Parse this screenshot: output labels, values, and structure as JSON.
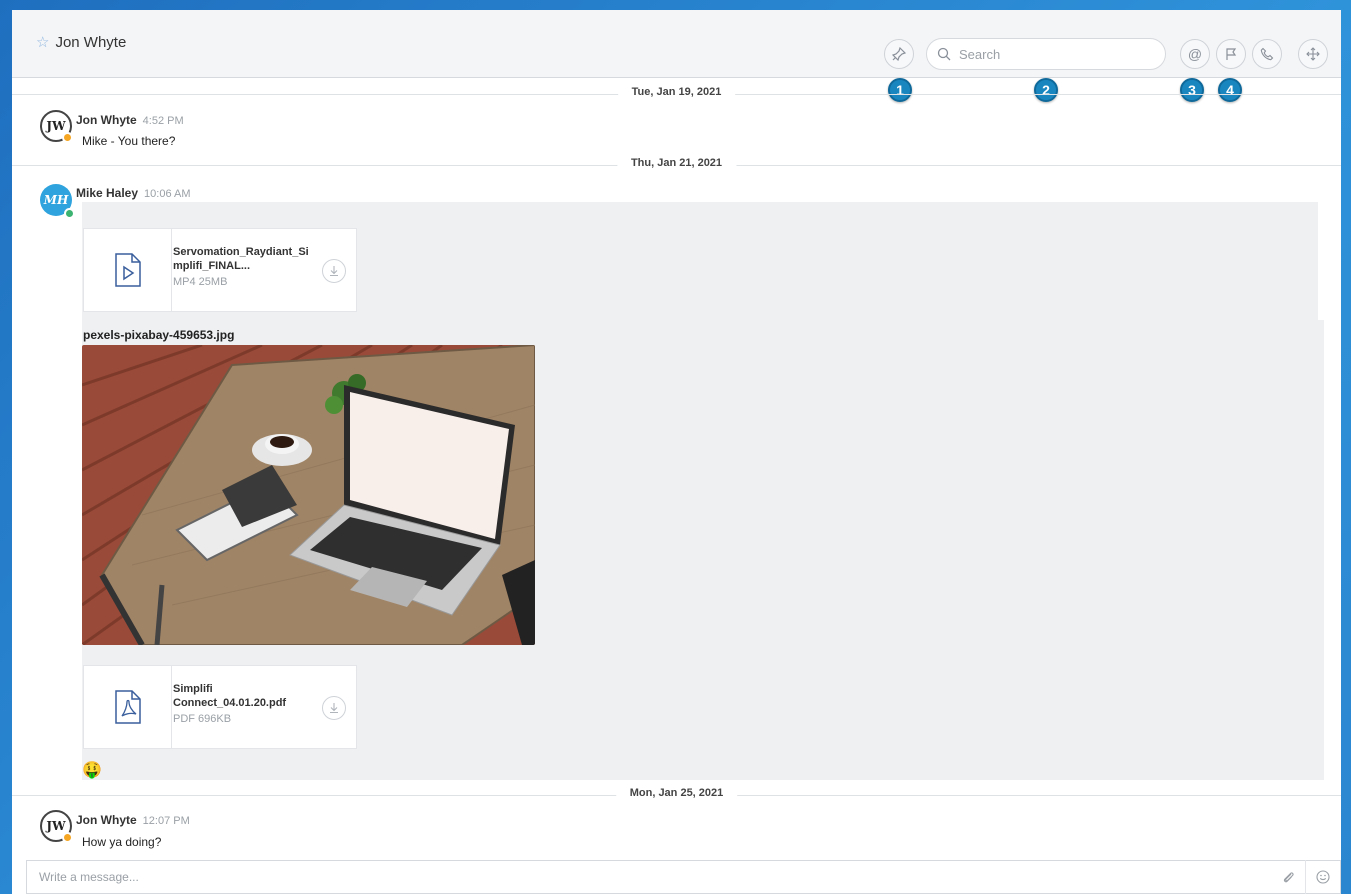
{
  "header": {
    "title": "Jon Whyte",
    "search_placeholder": "Search",
    "callouts": [
      "1",
      "2",
      "3",
      "4"
    ]
  },
  "dates": [
    "Tue, Jan 19, 2021",
    "Thu, Jan 21, 2021",
    "Mon, Jan 25, 2021"
  ],
  "messages": [
    {
      "initials": "JW",
      "sender": "Jon Whyte",
      "time": "4:52 PM",
      "text": "Mike - You there?",
      "status_color": "#f5a623"
    },
    {
      "initials": "MH",
      "sender": "Mike Haley",
      "time": "10:06 AM",
      "status_color": "#3cb371"
    },
    {
      "initials": "JW",
      "sender": "Jon Whyte",
      "time": "12:07 PM",
      "text": "How ya doing?",
      "status_color": "#f5a623"
    }
  ],
  "attachments": {
    "video": {
      "name": "Servomation_Raydiant_Si mplifi_FINAL...",
      "meta": "MP4 25MB"
    },
    "image_caption": "pexels-pixabay-459653.jpg",
    "pdf": {
      "name": "Simplifi Connect_04.01.20.pdf",
      "meta": "PDF 696KB"
    },
    "emoji": "🤑"
  },
  "composer": {
    "placeholder": "Write a message..."
  },
  "colors": {
    "accent": "#1a86bf",
    "background": "#2f93da"
  }
}
